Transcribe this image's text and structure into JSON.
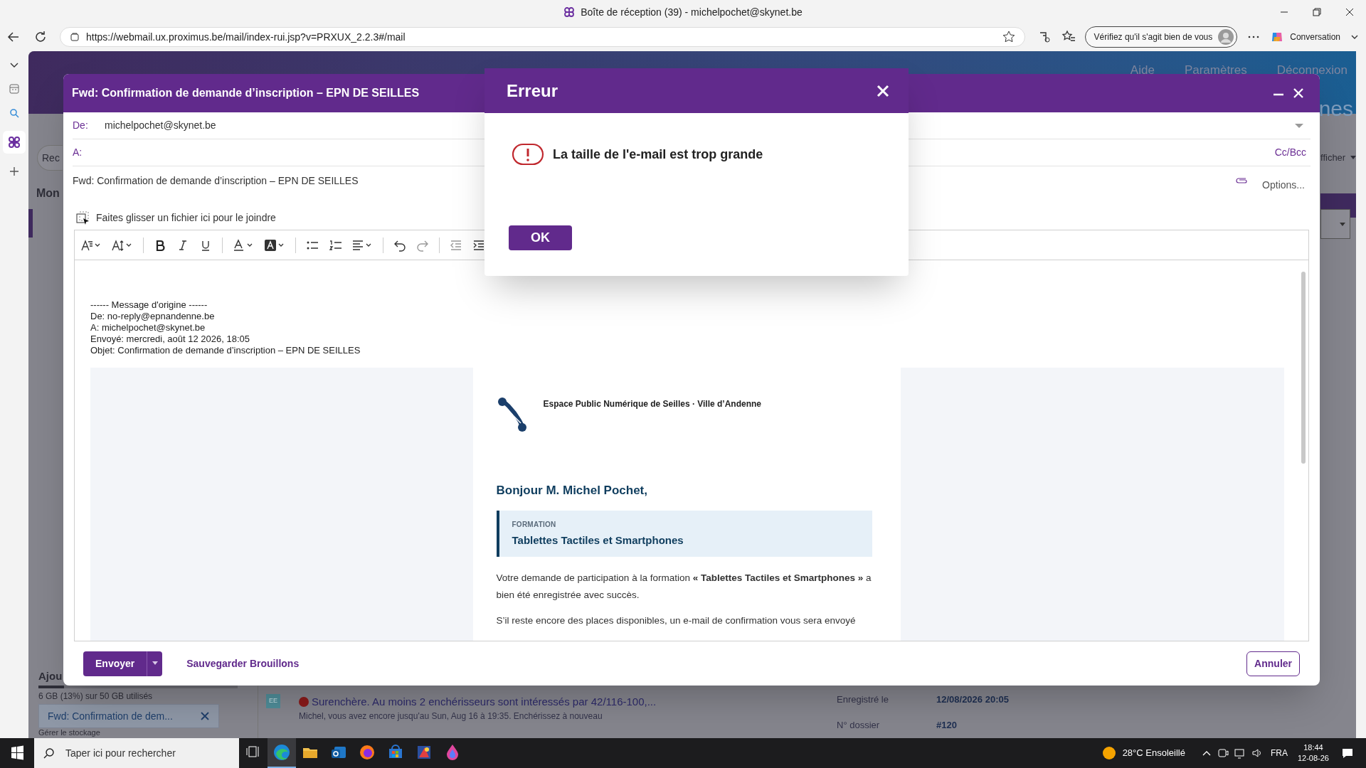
{
  "browser": {
    "window_title": "Boîte de réception (39) - michelpochet@skynet.be",
    "url": "https://webmail.ux.proximus.be/mail/index-rui.jsp?v=PRXUX_2.2.3#/mail",
    "identity_prompt": "Vérifiez qu'il s'agit bien de vous",
    "copilot": "Conversation"
  },
  "webmail": {
    "nav": [
      "Aide",
      "Paramètres",
      "Déconnexion"
    ],
    "banner_fragment": "nes",
    "search_button_fragment": "Rec",
    "folder_heading_fragment": "Mon",
    "display_menu_fragment": "fficher",
    "add_fragment": "Ajou",
    "storage": {
      "text": "6 GB (13%) sur 50 GB utilisés",
      "level": 0.13
    },
    "manage_storage": "Gérer le stockage",
    "minimized_draft": "Fwd: Confirmation de dem...",
    "message": {
      "avatar": "EE",
      "subject": "Surenchère. Au moins 2 enchérisseurs sont intéressés par 42/116-100,...",
      "preview": "Michel, vous avez encore jusqu'au Sun, Aug 16 à 19:35. Enchérissez à nouveau"
    },
    "details": [
      {
        "label": "Enregistré le",
        "value": "12/08/2026 20:05"
      },
      {
        "label": "N° dossier",
        "value": "#120"
      }
    ]
  },
  "compose": {
    "title": "Fwd: Confirmation de demande d’inscription – EPN DE SEILLES",
    "from_label": "De:",
    "from": "michelpochet@skynet.be",
    "to_label": "A:",
    "cc_bcc": "Cc/Bcc",
    "subject": "Fwd: Confirmation de demande d’inscription – EPN DE SEILLES",
    "options": "Options...",
    "drop_hint": "Faites glisser un fichier ici pour le joindre",
    "forward_header": [
      "------ Message d'origine ------",
      "De: no-reply@epnandenne.be",
      "A: michelpochet@skynet.be",
      "Envoyé: mercredi, août 12 2026, 18:05",
      "Objet: Confirmation de demande d’inscription – EPN DE SEILLES"
    ],
    "org": "Espace Public Numérique de Seilles · Ville d’Andenne",
    "greeting": "Bonjour M. Michel Pochet,",
    "card": {
      "label": "FORMATION",
      "title": "Tablettes Tactiles et Smartphones"
    },
    "paragraphs": [
      "Votre demande de participation à la formation **« Tablettes Tactiles et Smartphones »** a bien été enregistrée avec succès.",
      "S’il reste encore des places disponibles, un e-mail de confirmation vous sera envoyé"
    ],
    "send": "Envoyer",
    "save": "Sauvegarder Brouillons",
    "cancel": "Annuler"
  },
  "error": {
    "title": "Erreur",
    "message": "La taille de l'e-mail est trop grande",
    "ok": "OK"
  },
  "taskbar": {
    "search_placeholder": "Taper ici pour rechercher",
    "apps": [
      {
        "kind": "taskview",
        "selected": false
      },
      {
        "kind": "edge",
        "selected": true
      },
      {
        "kind": "files",
        "selected": false
      },
      {
        "kind": "mail",
        "selected": false
      },
      {
        "kind": "firefox",
        "selected": false
      },
      {
        "kind": "store",
        "selected": false
      },
      {
        "kind": "paint",
        "selected": false
      },
      {
        "kind": "drop",
        "selected": false
      }
    ],
    "weather": "28°C Ensoleillé",
    "language": "FRA",
    "time": "18:44",
    "date": "12-08-26"
  }
}
